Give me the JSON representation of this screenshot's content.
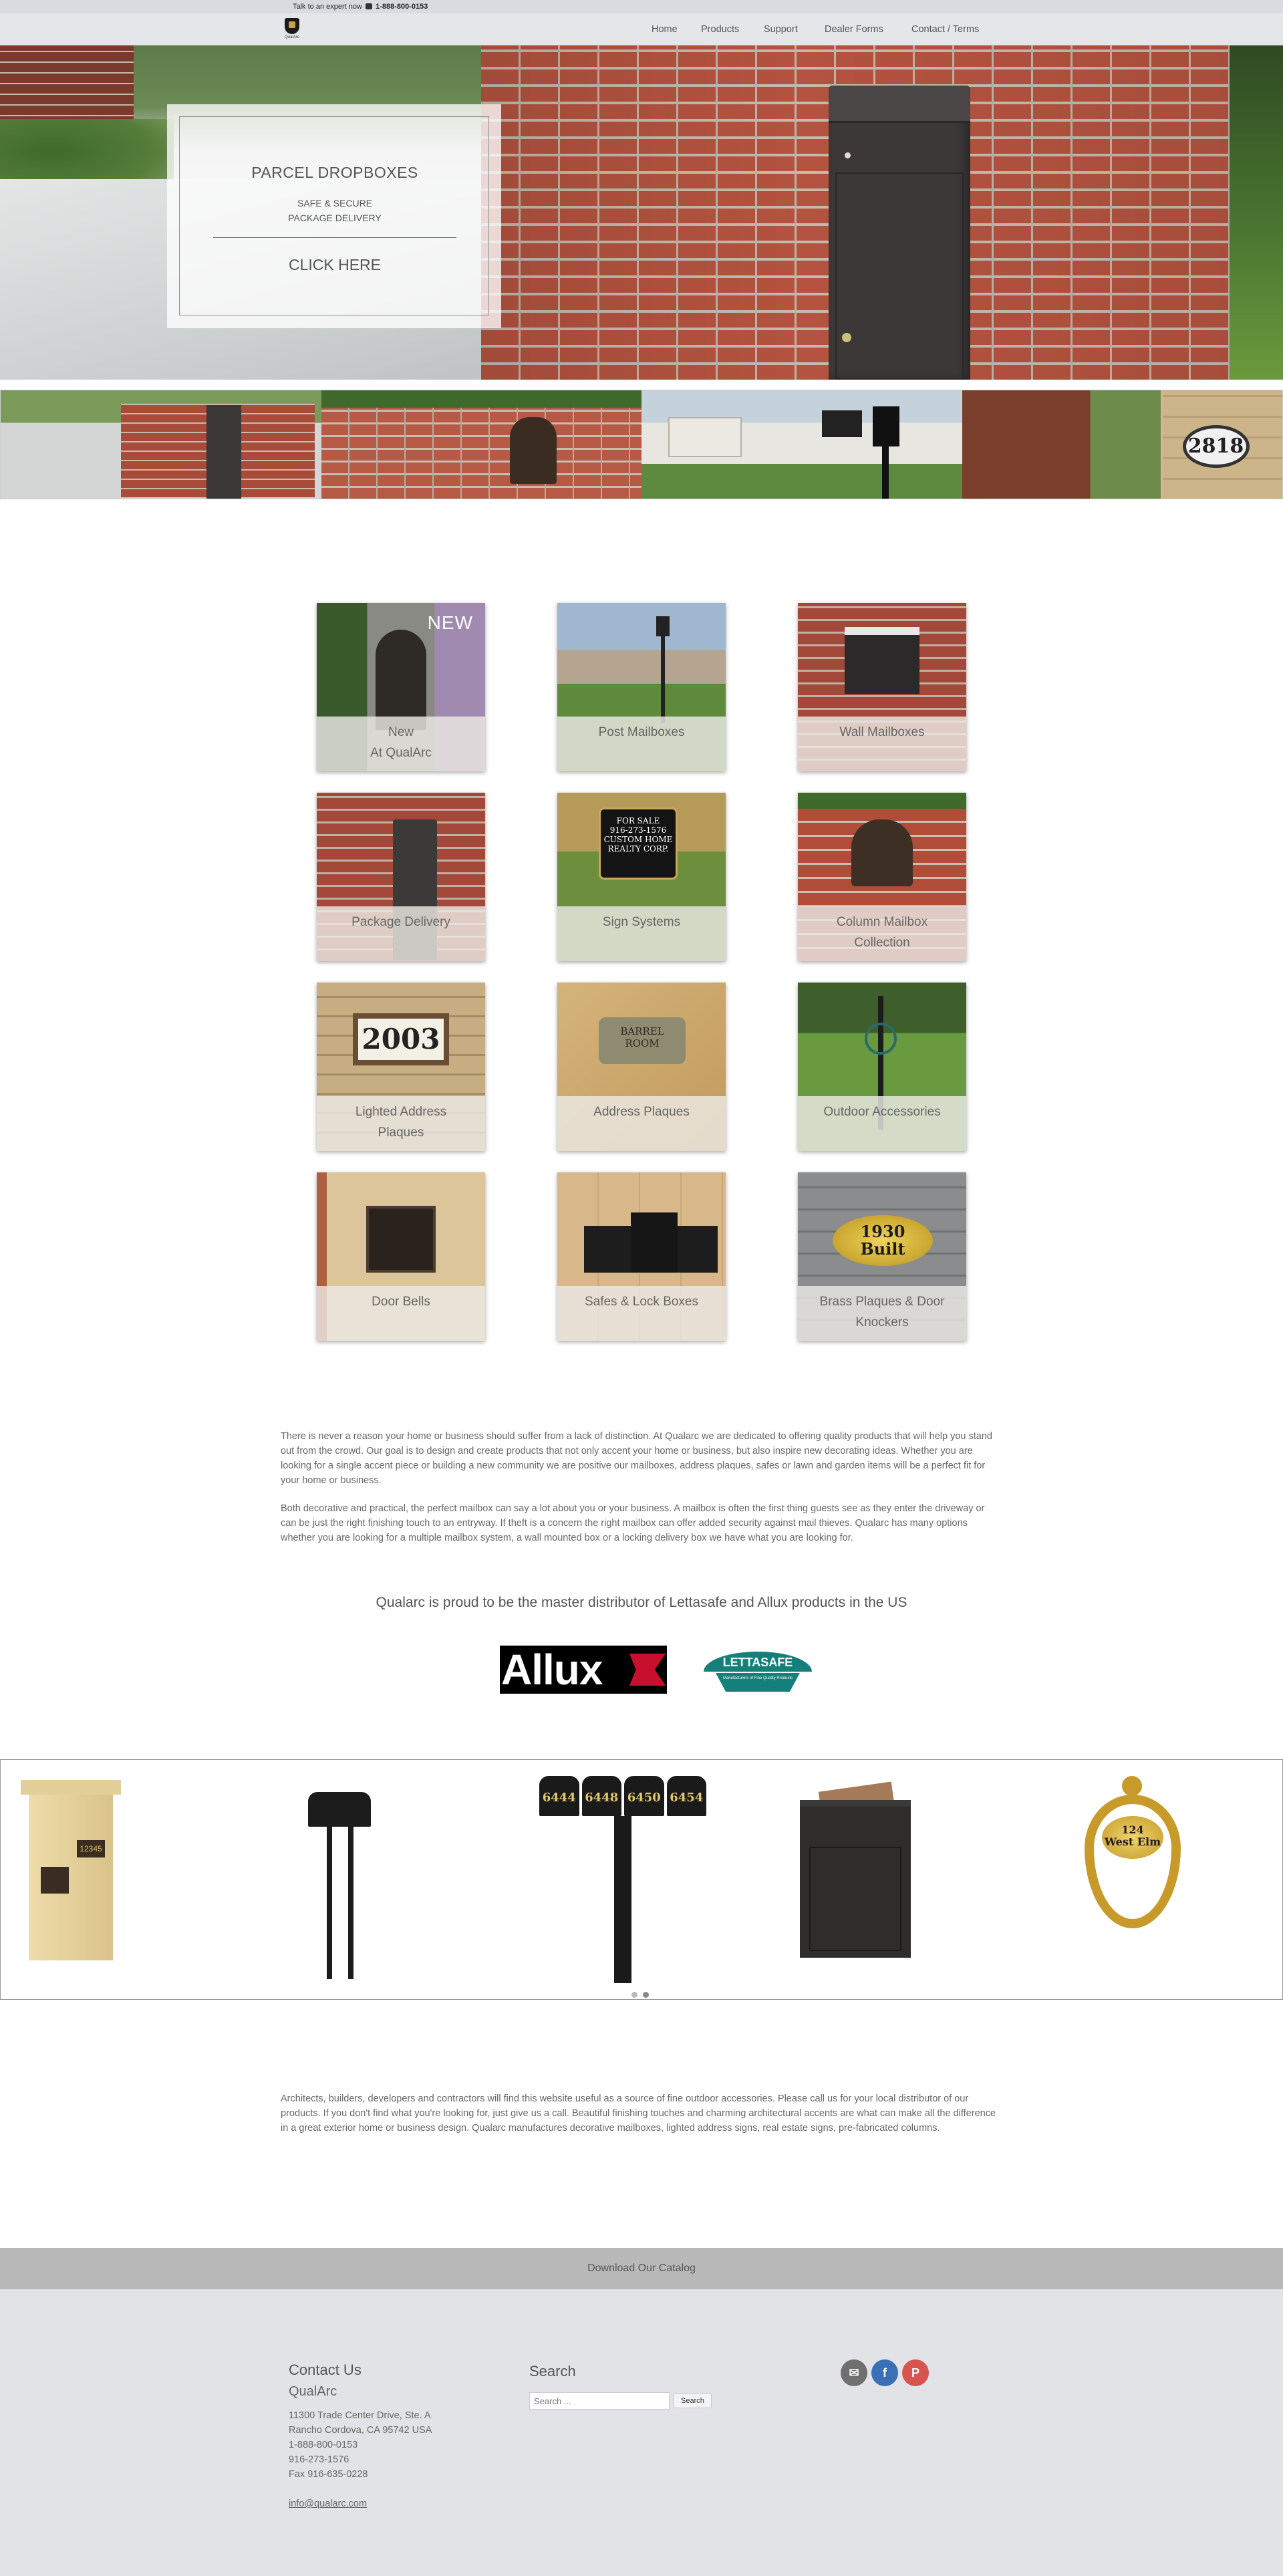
{
  "topbar": {
    "talk": "Talk to an expert now",
    "phone": "1-888-800-0153"
  },
  "brand": {
    "name": "QualArc"
  },
  "nav": {
    "items": [
      "Home",
      "Products",
      "Support",
      "Dealer Forms",
      "Contact / Terms"
    ]
  },
  "hero": {
    "title": "PARCEL DROPBOXES",
    "line1": "SAFE & SECURE",
    "line2": "PACKAGE DELIVERY",
    "cta": "CLICK HERE"
  },
  "gallery": {
    "plaque_number": "2818"
  },
  "categories": [
    {
      "label": "New\nAt QualArc",
      "badge": "NEW"
    },
    {
      "label": "Post Mailboxes"
    },
    {
      "label": "Wall Mailboxes"
    },
    {
      "label": "Package Delivery"
    },
    {
      "label": "Sign Systems",
      "sign_text": "FOR SALE\n916-273-1576\nCUSTOM HOME\nREALTY CORP."
    },
    {
      "label": "Column Mailbox\nCollection"
    },
    {
      "label": "Lighted Address\nPlaques",
      "plaque_text": "2003"
    },
    {
      "label": "Address Plaques",
      "plaque_text": "BARREL\nROOM"
    },
    {
      "label": "Outdoor Accessories"
    },
    {
      "label": "Door Bells"
    },
    {
      "label": "Safes & Lock Boxes"
    },
    {
      "label": "Brass Plaques & Door\nKnockers",
      "plaque_text": "1930\nBuilt"
    }
  ],
  "copy": {
    "p1": "There is never a reason your home or business should suffer from a lack of distinction. At Qualarc we are dedicated to offering quality products that will help you stand out from the crowd. Our goal is to design and create products that not only accent your home or business, but also inspire new decorating ideas. Whether you are looking for a single accent piece or building a new community we are positive our mailboxes, address plaques, safes or lawn and garden items will be a perfect fit for your home or business.",
    "p2": "Both decorative and practical, the perfect mailbox can say a lot about you or your business. A mailbox is often the first thing guests see as they enter the driveway or can be just the right finishing touch to an entryway. If theft is a concern the right mailbox can offer added security against mail thieves. Qualarc has many options whether you are looking for a multiple mailbox system, a wall mounted box or a locking delivery box we have what you are looking for.",
    "distributor": "Qualarc is proud to be the master distributor of Lettasafe and Allux products in the US",
    "p3": "Architects, builders, developers and contractors will find this website useful as a source of fine outdoor accessories. Please call us for your local distributor of our products. If you don't find what you're looking for, just give us a call. Beautiful finishing touches and charming architectural accents are what can make all the difference in a great exterior home or business design. Qualarc manufactures decorative mailboxes, lighted address signs, real estate signs, pre-fabricated columns."
  },
  "logos": {
    "allux": "Allux",
    "lettasafe": "LETTASAFE",
    "lettasafe_sub": "Manufacturers of Fine Quality Products"
  },
  "carousel": {
    "column_plate": "12345",
    "mailbox_numbers": [
      "6444",
      "6448",
      "6450",
      "6454"
    ],
    "knocker_text": "124\nWest Elm"
  },
  "catalog": {
    "label": "Download Our Catalog"
  },
  "footer": {
    "contact_heading": "Contact Us",
    "company": "QualArc",
    "address1": "11300 Trade Center Drive, Ste. A",
    "address2": "Rancho Cordova, CA 95742 USA",
    "phone1": "1-888-800-0153",
    "phone2": "916-273-1576",
    "fax": "Fax 916-635-0228",
    "email": "info@qualarc.com",
    "search_heading": "Search",
    "search_placeholder": "Search ...",
    "search_button": "Search"
  },
  "colors": {
    "email": "#6f6f6f",
    "facebook": "#3b6fb6",
    "pinterest": "#d9534f"
  }
}
